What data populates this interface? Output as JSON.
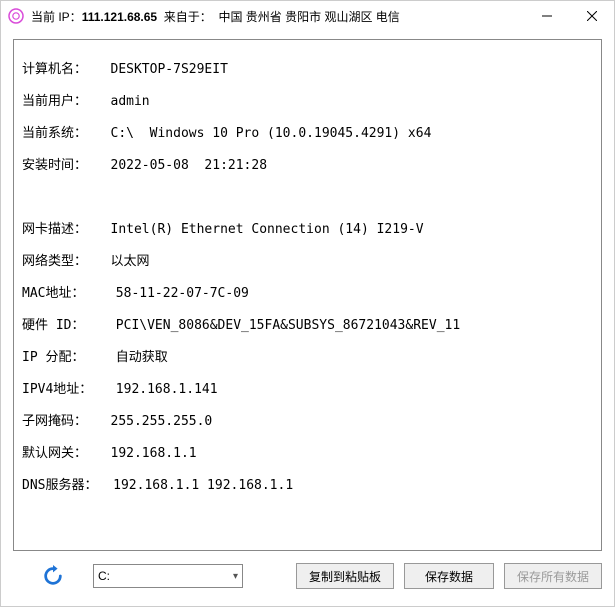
{
  "titlebar": {
    "prefix": "当前 IP：",
    "ip": "111.121.68.65",
    "from_label": "来自于：",
    "from_value": "中国 贵州省 贵阳市 观山湖区 电信"
  },
  "info": {
    "computer_name_label": "计算机名：",
    "computer_name": "DESKTOP-7S29EIT",
    "current_user_label": "当前用户：",
    "current_user": "admin",
    "os_label": "当前系统：",
    "os": "C:\\  Windows 10 Pro (10.0.19045.4291) x64",
    "install_time_label": "安装时间：",
    "install_time": "2022-05-08  21:21:28",
    "nic_desc_label": "网卡描述：",
    "nic_desc": "Intel(R) Ethernet Connection (14) I219-V",
    "net_type_label": "网络类型：",
    "net_type": "以太网",
    "mac_label": "MAC地址：",
    "mac": "58-11-22-07-7C-09",
    "hw_id_label": "硬件 ID：",
    "hw_id": "PCI\\VEN_8086&DEV_15FA&SUBSYS_86721043&REV_11",
    "ip_alloc_label": "IP 分配：",
    "ip_alloc": "自动获取",
    "ipv4_label": "IPV4地址：",
    "ipv4": "192.168.1.141",
    "subnet_label": "子网掩码：",
    "subnet": "255.255.255.0",
    "gateway_label": "默认网关：",
    "gateway": "192.168.1.1",
    "dns_label": "DNS服务器：",
    "dns": "192.168.1.1 192.168.1.1"
  },
  "bottom": {
    "drive_selected": "C:",
    "copy_btn": "复制到粘贴板",
    "save_btn": "保存数据",
    "save_all_btn": "保存所有数据"
  },
  "colors": {
    "refresh_blue": "#1e73d6"
  }
}
